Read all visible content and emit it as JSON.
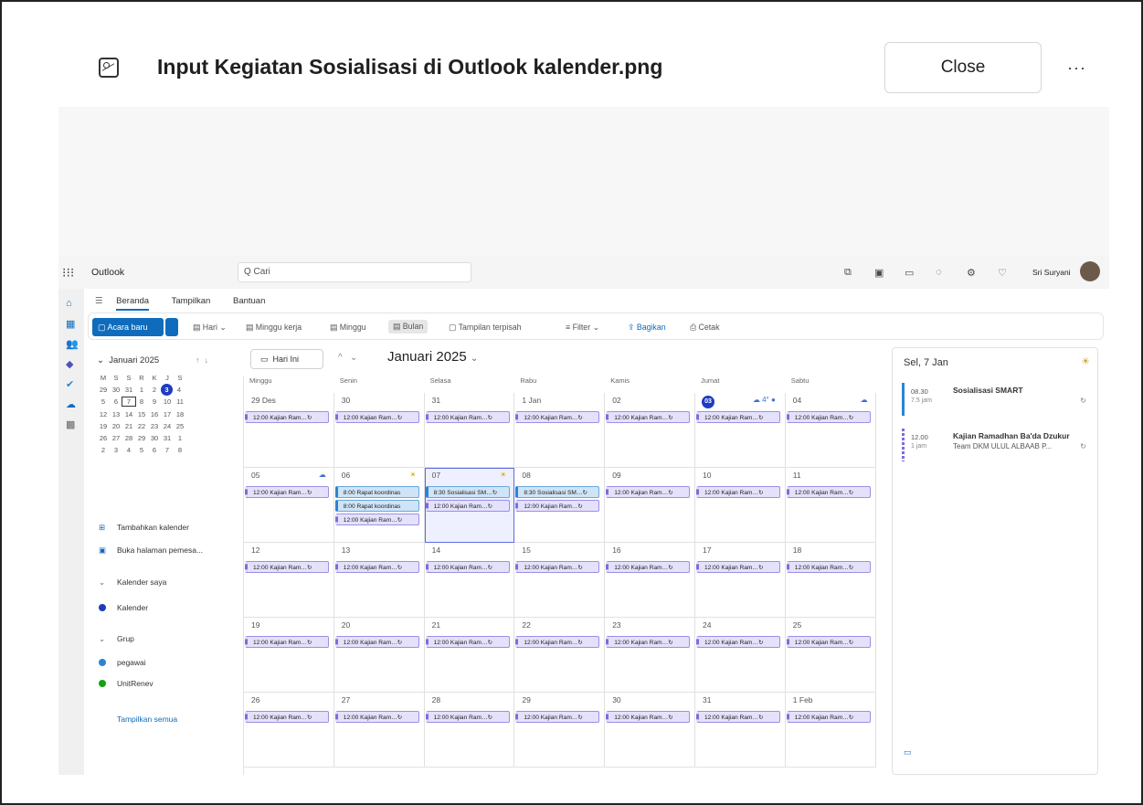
{
  "viewer": {
    "title": "Input Kegiatan Sosialisasi di Outlook kalender.png",
    "close": "Close",
    "more": "···"
  },
  "app": {
    "name": "Outlook",
    "search_placeholder": "Q Cari",
    "user": "Sri Suryani"
  },
  "tabs": [
    "Beranda",
    "Tampilkan",
    "Bantuan"
  ],
  "ribbon": {
    "new": "Acara baru",
    "day": "Hari",
    "workweek": "Minggu kerja",
    "week": "Minggu",
    "month": "Bulan",
    "split": "Tampilan terpisah",
    "filter": "Filter",
    "share": "Bagikan",
    "print": "Cetak"
  },
  "mini": {
    "title": "Januari 2025",
    "headers": [
      "M",
      "S",
      "S",
      "R",
      "K",
      "J",
      "S"
    ],
    "rows": [
      [
        "29",
        "30",
        "31",
        "1",
        "2",
        "3",
        "4"
      ],
      [
        "5",
        "6",
        "7",
        "8",
        "9",
        "10",
        "11"
      ],
      [
        "12",
        "13",
        "14",
        "15",
        "16",
        "17",
        "18"
      ],
      [
        "19",
        "20",
        "21",
        "22",
        "23",
        "24",
        "25"
      ],
      [
        "26",
        "27",
        "28",
        "29",
        "30",
        "31",
        "1"
      ],
      [
        "2",
        "3",
        "4",
        "5",
        "6",
        "7",
        "8"
      ]
    ]
  },
  "leftnav": {
    "add": "Tambahkan kalender",
    "booking": "Buka halaman pemesa...",
    "my": "Kalender saya",
    "cal": "Kalender",
    "group": "Grup",
    "g1": "pegawai",
    "g2": "UnitRenev",
    "showall": "Tampilkan semua"
  },
  "calendar": {
    "today": "Hari Ini",
    "month": "Januari 2025",
    "days": [
      "Minggu",
      "Senin",
      "Selasa",
      "Rabu",
      "Kamis",
      "Jumat",
      "Sabtu"
    ],
    "weeks": [
      [
        "29 Des",
        "30",
        "31",
        "1 Jan",
        "02",
        "03",
        "04"
      ],
      [
        "05",
        "06",
        "07",
        "08",
        "09",
        "10",
        "11"
      ],
      [
        "12",
        "13",
        "14",
        "15",
        "16",
        "17",
        "18"
      ],
      [
        "19",
        "20",
        "21",
        "22",
        "23",
        "24",
        "25"
      ],
      [
        "26",
        "27",
        "28",
        "29",
        "30",
        "31",
        "1 Feb"
      ]
    ],
    "ev_kajian": "12:00 Kajian Ram…↻",
    "ev_rapat": "8:00 Rapat koordinas",
    "ev_sos": "8:30 Sosialisasi SM…↻",
    "weather_fri": "☁ 4°"
  },
  "agenda": {
    "title": "Sel, 7 Jan",
    "items": [
      {
        "time": "08.30",
        "dur": "7.5 jam",
        "name": "Sosialisasi SMART",
        "sub": ""
      },
      {
        "time": "12.00",
        "dur": "1 jam",
        "name": "Kajian Ramadhan Ba'da Dzukur",
        "sub": "Team DKM ULUL ALBAAB P..."
      }
    ]
  },
  "colors": {
    "accent": "#0f6cbd",
    "today": "#1e3cc0",
    "event_purple": "#e4e1fb",
    "event_blue": "#cfe4f6",
    "group_green": "#13a10e"
  }
}
